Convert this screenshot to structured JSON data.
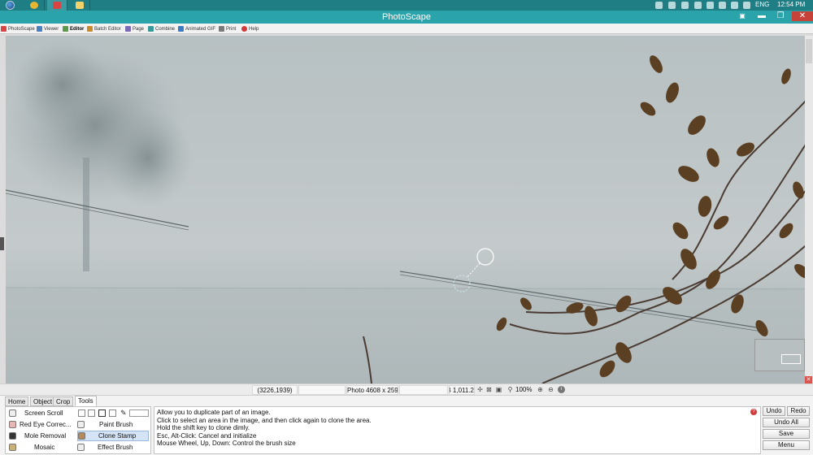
{
  "taskbar": {
    "language": "ENG",
    "time": "12:54 PM",
    "apps": [
      {
        "name": "chrome",
        "color": "#e8b533"
      },
      {
        "name": "photoscape",
        "color": "#d84343"
      },
      {
        "name": "file-explorer",
        "color": "#f2d36b"
      }
    ]
  },
  "window": {
    "title": "PhotoScape",
    "close_glyph": "✕",
    "minimize_glyph": "▬",
    "maximize_glyph": "❐"
  },
  "tabs": [
    {
      "label": "PhotoScape",
      "icon": "photoscape-icon",
      "color": "#d84343"
    },
    {
      "label": "Viewer",
      "icon": "viewer-icon",
      "color": "#4a7fc1"
    },
    {
      "label": "Editor",
      "icon": "editor-icon",
      "color": "#5b9a4a",
      "active": true
    },
    {
      "label": "Batch Editor",
      "icon": "batch-editor-icon",
      "color": "#c98a2b"
    },
    {
      "label": "Page",
      "icon": "page-icon",
      "color": "#7b6bb5"
    },
    {
      "label": "Combine",
      "icon": "combine-icon",
      "color": "#3a9a9a"
    },
    {
      "label": "Animated GIF",
      "icon": "animated-gif-icon",
      "color": "#3c7cc4"
    },
    {
      "label": "Print",
      "icon": "print-icon",
      "color": "#7a7a7a"
    },
    {
      "label": "Help",
      "icon": "help-icon",
      "color": "#d23b3b"
    }
  ],
  "status": {
    "coordinates": "(3226,1939)",
    "photo_info": "Photo 4608 x 2592",
    "file_size": "1,011.2 KB",
    "zoom": "100%"
  },
  "tool_tabs": [
    "Home",
    "Object",
    "Crop",
    "Tools"
  ],
  "active_tool_tab": "Tools",
  "tools_left": [
    {
      "label": "Screen Scroll",
      "icon": "hand-icon"
    },
    {
      "label": "Red Eye Correc...",
      "icon": "red-eye-icon"
    },
    {
      "label": "Mole Removal",
      "icon": "mole-removal-icon"
    },
    {
      "label": "Mosaic",
      "icon": "mosaic-icon"
    }
  ],
  "tools_right": [
    {
      "label": "Paint Brush",
      "icon": "paint-brush-icon"
    },
    {
      "label": "Clone Stamp",
      "icon": "clone-stamp-icon",
      "selected": true
    },
    {
      "label": "Effect Brush",
      "icon": "effect-brush-icon"
    }
  ],
  "description": [
    "Allow you to duplicate part of an image.",
    "Click to select an area in the image, and then click again to clone the area.",
    "Hold the shift key to clone dimly.",
    "Esc, Alt-Click: Cancel and initialize",
    "Mouse Wheel, Up, Down: Control the brush size"
  ],
  "actions": {
    "undo": "Undo",
    "redo": "Redo",
    "undo_all": "Undo All",
    "save": "Save",
    "menu": "Menu"
  }
}
